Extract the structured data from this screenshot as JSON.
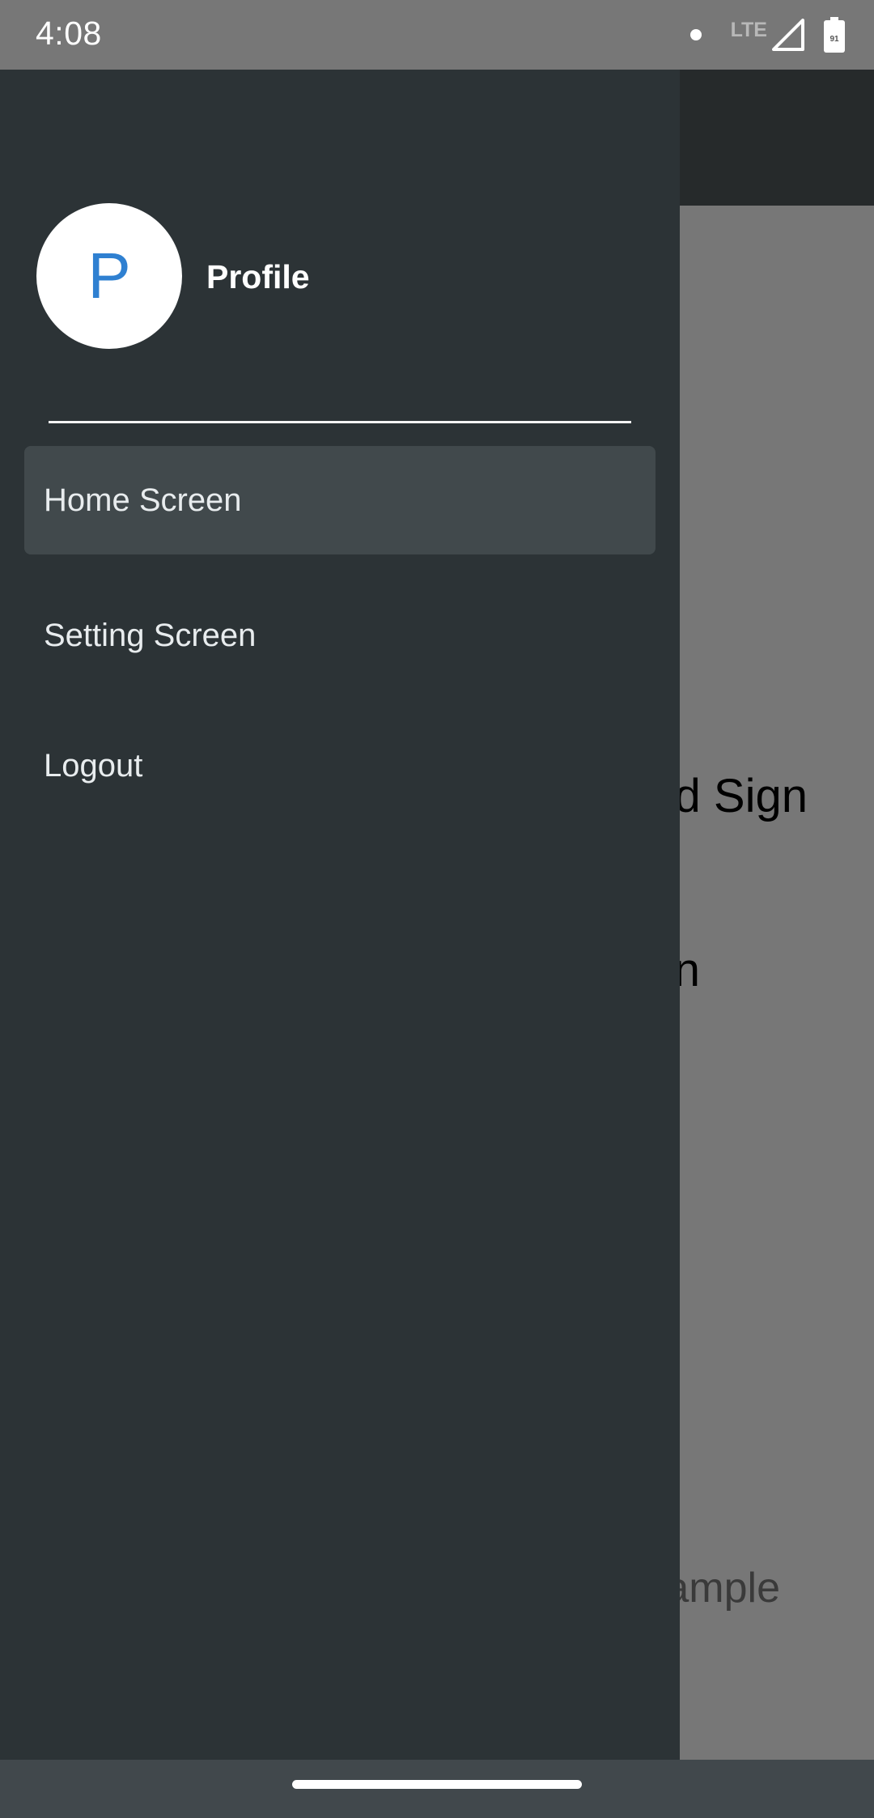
{
  "status_bar": {
    "time": "4:08",
    "network_label": "LTE",
    "battery_level": "91",
    "icons": [
      "notification-dot-icon",
      "lte-icon",
      "cell-signal-icon",
      "battery-icon"
    ]
  },
  "background": {
    "visible_text": [
      "d Sign",
      "n",
      "ample"
    ]
  },
  "drawer": {
    "avatar_letter": "P",
    "profile_label": "Profile",
    "items": [
      {
        "label": "Home Screen",
        "selected": true
      },
      {
        "label": "Setting Screen",
        "selected": false
      },
      {
        "label": "Logout",
        "selected": false
      }
    ]
  },
  "colors": {
    "drawer_bg": "#2c3336",
    "selected_item_bg": "#41494c",
    "avatar_letter": "#2f80d1",
    "scrim": "#777777",
    "nav_bar": "#41484c"
  }
}
